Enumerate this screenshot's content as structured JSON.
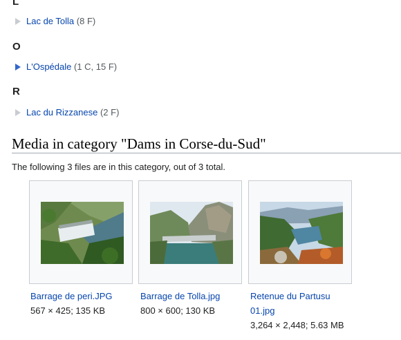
{
  "subcategories": [
    {
      "letter": "L",
      "name": "Lac de Tolla",
      "count": "(8 F)",
      "expanded": false
    },
    {
      "letter": "O",
      "name": "L'Ospédale",
      "count": "(1 C, 15 F)",
      "expanded": true
    },
    {
      "letter": "R",
      "name": "Lac du Rizzanese",
      "count": "(2 F)",
      "expanded": false
    }
  ],
  "media": {
    "heading": "Media in category \"Dams in Corse-du-Sud\"",
    "summary": "The following 3 files are in this category, out of 3 total.",
    "files": [
      {
        "name": "Barrage de peri.JPG",
        "meta": "567 × 425; 135 KB",
        "icon": "thumbnail-spillway-dam"
      },
      {
        "name": "Barrage de Tolla.jpg",
        "meta": "800 × 600; 130 KB",
        "icon": "thumbnail-tolla-dam"
      },
      {
        "name": "Retenue du Partusu 01.jpg",
        "meta": "3,264 × 2,448; 5.63 MB",
        "icon": "thumbnail-partusu-reservoir"
      }
    ]
  },
  "colors": {
    "link": "#0645ad",
    "expanded_arrow": "#3366cc",
    "collapsed_arrow": "#c8ccd1"
  }
}
